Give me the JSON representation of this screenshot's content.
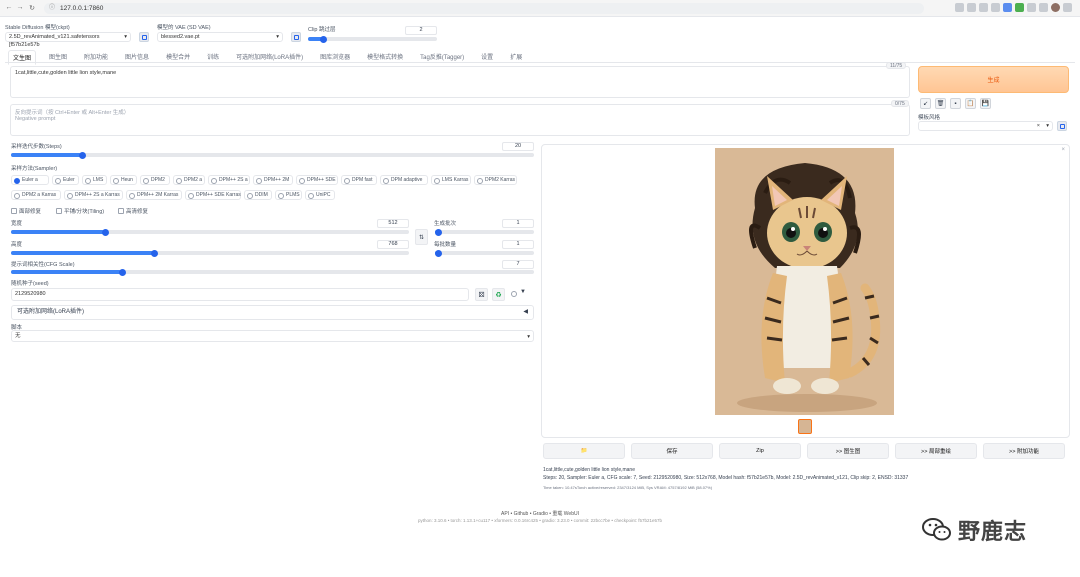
{
  "browser": {
    "url": "127.0.0.1:7860"
  },
  "top": {
    "model_label": "Stable Diffusion 模型(ckpt)",
    "model_value": "2.5D_revAnimated_v121.safetensors [f57b21e57b",
    "vae_label": "模型的 VAE (SD VAE)",
    "vae_value": "blessed2.vae.pt",
    "clip_label": "Clip 跳过层",
    "clip_value": "2"
  },
  "tabs": [
    "文生图",
    "图生图",
    "附加功能",
    "图片信息",
    "模型合并",
    "训练",
    "可选附加网络(LoRA插件)",
    "图库浏览器",
    "模型格式转换",
    "Tag反推(Tagger)",
    "设置",
    "扩展"
  ],
  "prompt": {
    "text": "1cat,little,cute,golden little lion style,mane",
    "counter": "11/75"
  },
  "negative": {
    "placeholder1": "反向提示词（按 Ctrl+Enter 或 Alt+Enter 生成）",
    "placeholder2": "Negative prompt",
    "counter": "0/75"
  },
  "generate_label": "生成",
  "style_label": "模板风格",
  "steps": {
    "label": "采样迭代步数(Steps)",
    "value": "20"
  },
  "sampler": {
    "label": "采样方法(Sampler)",
    "selected": "Euler a",
    "options_row1": [
      "Euler a",
      "Euler",
      "LMS",
      "Heun",
      "DPM2",
      "DPM2 a",
      "DPM++ 2S a",
      "DPM++ 2M",
      "DPM++ SDE",
      "DPM fast",
      "DPM adaptive",
      "LMS Karras",
      "DPM2 Karras"
    ],
    "options_row2": [
      "DPM2 a Karras",
      "DPM++ 2S a Karras",
      "DPM++ 2M Karras",
      "DPM++ SDE Karras",
      "DDIM",
      "PLMS",
      "UniPC"
    ]
  },
  "checks": [
    "面部修复",
    "平铺/分块(Tiling)",
    "高清修复"
  ],
  "width": {
    "label": "宽度",
    "value": "512"
  },
  "height": {
    "label": "高度",
    "value": "768"
  },
  "batch_count": {
    "label": "生成批次",
    "value": "1"
  },
  "batch_size": {
    "label": "每批数量",
    "value": "1"
  },
  "cfg": {
    "label": "提示词相关性(CFG Scale)",
    "value": "7"
  },
  "seed": {
    "label": "随机种子(seed)",
    "value": "2129520980"
  },
  "extra_networks": "可选附加网络(LoRA插件)",
  "script": {
    "label": "脚本",
    "value": "无"
  },
  "actions": [
    "保存",
    "Zip",
    ">> 图生图",
    ">> 局部重绘",
    ">> 附加功能"
  ],
  "info": {
    "line1": "1cat,little,cute,golden little lion style,mane",
    "line2": "Steps: 20, Sampler: Euler a, CFG scale: 7, Seed: 2129520980, Size: 512x768, Model hash: f57b21e57b, Model: 2.5D_revAnimated_v121, Clip skip: 2, ENSD: 31337",
    "line3": "Time taken: 10.47sTorch active/reserved: 2347/3124 MiB, Sys VRAM: 4757/8192 MiB (58.07%)"
  },
  "footer": {
    "line1": "API  •  Github  •  Gradio  •  重载 WebUI",
    "line2": "python: 3.10.6  •  torch: 1.13.1+cu117  •  xformers: 0.0.16rc425  •  gradio: 3.23.0  •  commit: 22bcc7be  •  checkpoint: f57b21e57b"
  },
  "watermark": "野鹿志",
  "accent": "#2563eb",
  "generate_color": "#ea580c"
}
